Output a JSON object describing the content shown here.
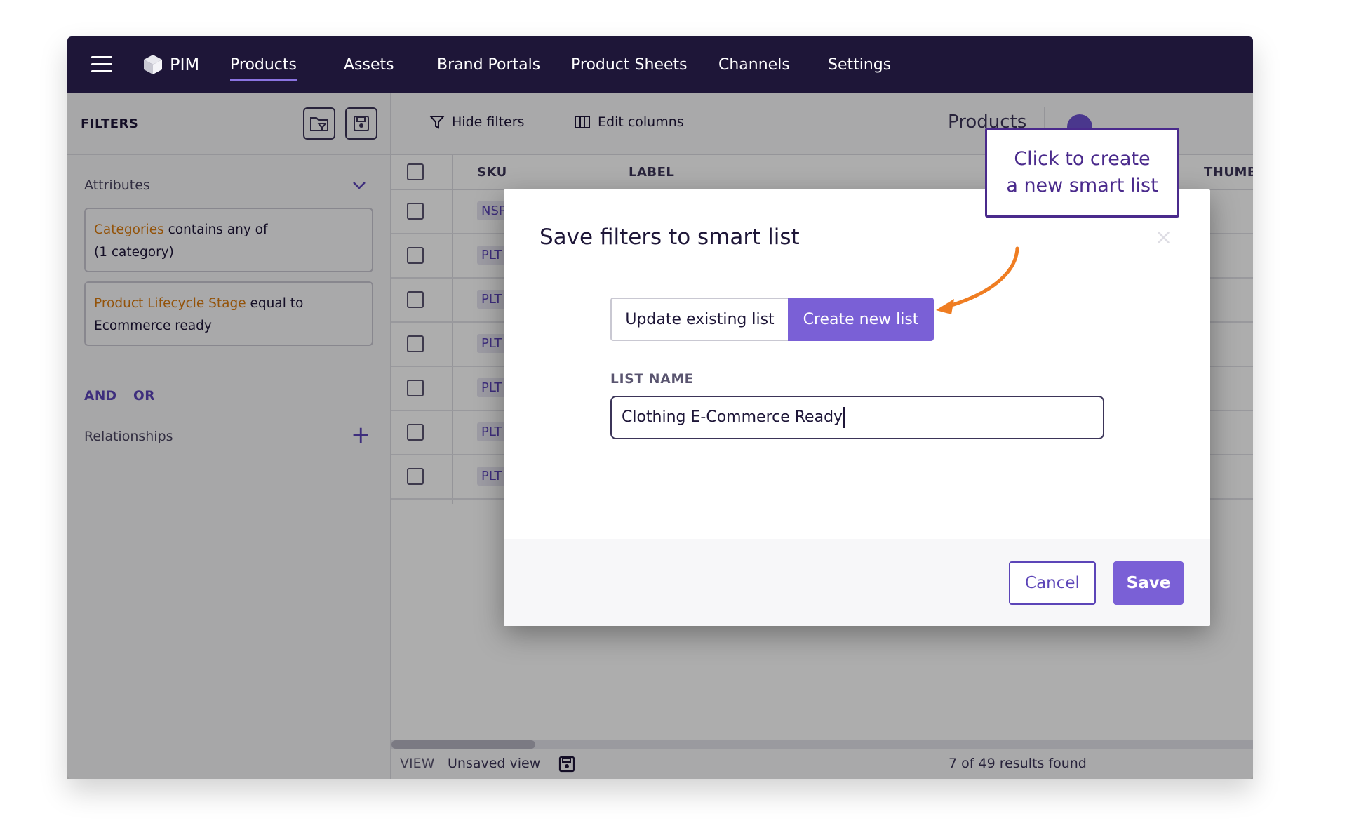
{
  "nav": {
    "brand": "PIM",
    "items": [
      "Products",
      "Assets",
      "Brand Portals",
      "Product Sheets",
      "Channels",
      "Settings"
    ],
    "active": "Products"
  },
  "filters": {
    "title": "FILTERS",
    "attributes_label": "Attributes",
    "cards": [
      {
        "attribute": "Categories",
        "rest": " contains any of",
        "line2": "(1 category)"
      },
      {
        "attribute": "Product Lifecycle Stage",
        "rest": " equal to",
        "line2": "Ecommerce ready"
      }
    ],
    "and_label": "AND",
    "or_label": "OR",
    "relationships_label": "Relationships"
  },
  "toolbar": {
    "hide_filters": "Hide filters",
    "edit_columns": "Edit columns",
    "products_label": "Products"
  },
  "table": {
    "columns": [
      "SKU",
      "LABEL",
      "THUMBN"
    ],
    "sku_prefixes": [
      "NSP",
      "PLT",
      "PLT",
      "PLT",
      "PLT",
      "PLT",
      "PLT"
    ]
  },
  "footer": {
    "view_label": "VIEW",
    "view_name": "Unsaved view",
    "results": "7 of 49 results found"
  },
  "modal": {
    "title": "Save filters to smart list",
    "close": "×",
    "toggle_update": "Update existing list",
    "toggle_create": "Create new list",
    "field_label": "LIST NAME",
    "field_value": "Clothing E-Commerce Ready",
    "cancel": "Cancel",
    "save": "Save"
  },
  "callout": {
    "line1": "Click to create",
    "line2": "a new smart list"
  },
  "colors": {
    "nav_bg": "#1e1638",
    "accent": "#7a60d6",
    "highlight": "#d97b10",
    "arrow": "#ef7d22"
  }
}
